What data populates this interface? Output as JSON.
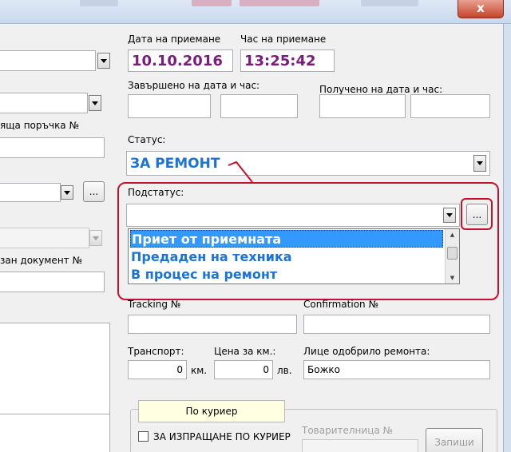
{
  "window": {
    "close_glyph": "x"
  },
  "fields": {
    "date_received_label": "Дата на приемане",
    "date_received_value": "10.10.2016",
    "time_received_label": "Час на приемане",
    "time_received_value": "13:25:42",
    "completed_label": "Завършено на дата и час:",
    "received_label": "Получено на дата и час:",
    "status_label": "Статус:",
    "status_value": "ЗА РЕМОНТ",
    "substatus_label": "Подстатус:",
    "substatus_options": [
      "Приет от приемната",
      "Предаден на техника",
      "В процес на ремонт"
    ],
    "tracking_label": "Tracking №",
    "confirmation_label": "Confirmation №",
    "transport_label": "Транспорт:",
    "transport_value": "0",
    "transport_unit": "км.",
    "price_label": "Цена за км.:",
    "price_value": "0",
    "price_unit": "лв.",
    "approver_label": "Лице одобрило ремонта:",
    "approver_value": "Божко"
  },
  "left_panel": {
    "order_label": "ящa поръчка №",
    "doc_label": "зан документ №"
  },
  "courier": {
    "tooltip": "По куриер",
    "checkbox_label": "ЗА ИЗПРАЩАНЕ ПО КУРИЕР",
    "waybill_label": "Товарителница №",
    "send_button": "Запиши"
  },
  "buttons": {
    "ellipsis": "..."
  },
  "colors": {
    "status_blue": "#1a73d9",
    "date_purple": "#7b1b7e",
    "highlight": "#c8102e",
    "selection": "#3399ff"
  }
}
